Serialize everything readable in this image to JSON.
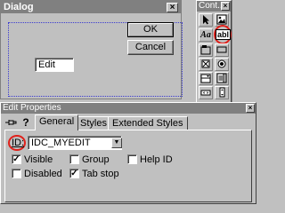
{
  "dialog": {
    "title": "Dialog",
    "close_glyph": "×",
    "ok_label": "OK",
    "cancel_label": "Cancel",
    "edit_text": "Edit"
  },
  "controls": {
    "title": "Cont...",
    "close_glyph": "×",
    "tools": [
      "pointer-tool",
      "picture-tool",
      "static-text-tool",
      "edit-box-tool",
      "group-box-tool",
      "button-tool",
      "check-box-tool",
      "radio-button-tool",
      "combo-box-tool",
      "list-box-tool",
      "h-scroll-tool",
      "v-scroll-tool",
      "spin-tool",
      "progress-tool"
    ],
    "highlight": "#e0201a"
  },
  "props": {
    "title": "Edit Properties",
    "close_glyph": "×",
    "tabs": [
      "General",
      "Styles",
      "Extended Styles"
    ],
    "id_label": "ID:",
    "id_value": "IDC_MYEDIT",
    "checkboxes": {
      "visible": {
        "label": "Visible",
        "checked": true
      },
      "disabled": {
        "label": "Disabled",
        "checked": false
      },
      "group": {
        "label": "Group",
        "checked": false
      },
      "tab_stop": {
        "label": "Tab stop",
        "checked": true
      },
      "help_id": {
        "label": "Help ID",
        "checked": false
      }
    }
  },
  "colors": {
    "face": "#c0c0c0",
    "titlebar_inactive": "#808080",
    "guide": "#3a3ad0"
  }
}
